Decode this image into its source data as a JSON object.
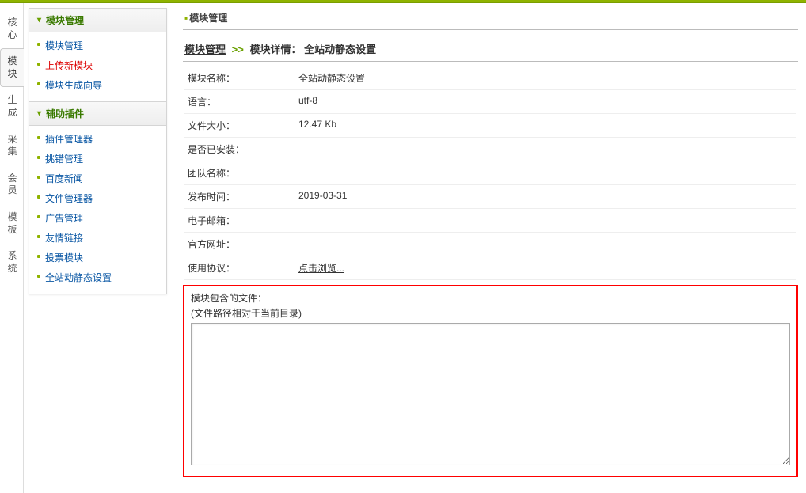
{
  "vtabs": {
    "items": [
      {
        "label": "核心"
      },
      {
        "label": "模块",
        "active": true
      },
      {
        "label": "生成"
      },
      {
        "label": "采集"
      },
      {
        "label": "会员"
      },
      {
        "label": "模板"
      },
      {
        "label": "系统"
      }
    ]
  },
  "sidebar": {
    "sections": [
      {
        "title": "模块管理",
        "items": [
          {
            "label": "模块管理"
          },
          {
            "label": "上传新模块",
            "hot": true
          },
          {
            "label": "模块生成向导"
          }
        ]
      },
      {
        "title": "辅助插件",
        "items": [
          {
            "label": "插件管理器"
          },
          {
            "label": "挑错管理"
          },
          {
            "label": "百度新闻"
          },
          {
            "label": "文件管理器"
          },
          {
            "label": "广告管理"
          },
          {
            "label": "友情链接"
          },
          {
            "label": "投票模块"
          },
          {
            "label": "全站动静态设置"
          }
        ]
      }
    ]
  },
  "main": {
    "panel_title": "模块管理",
    "breadcrumb": {
      "root": "模块管理",
      "sep": ">>",
      "detail_label": "模块详情：",
      "detail_name": "全站动静态设置"
    },
    "fields": {
      "module_name": {
        "label": "模块名称：",
        "value": "全站动静态设置"
      },
      "language": {
        "label": "语言：",
        "value": "utf-8"
      },
      "file_size": {
        "label": "文件大小：",
        "value": "12.47 Kb"
      },
      "installed": {
        "label": "是否已安装：",
        "value": ""
      },
      "team": {
        "label": "团队名称：",
        "value": ""
      },
      "pub_date": {
        "label": "发布时间：",
        "value": "2019-03-31"
      },
      "email": {
        "label": "电子邮箱：",
        "value": ""
      },
      "website": {
        "label": "官方网址：",
        "value": ""
      },
      "license": {
        "label": "使用协议：",
        "value": "点击浏览..."
      }
    },
    "files": {
      "label": "模块包含的文件：",
      "note": "(文件路径相对于当前目录)",
      "content": ""
    }
  }
}
